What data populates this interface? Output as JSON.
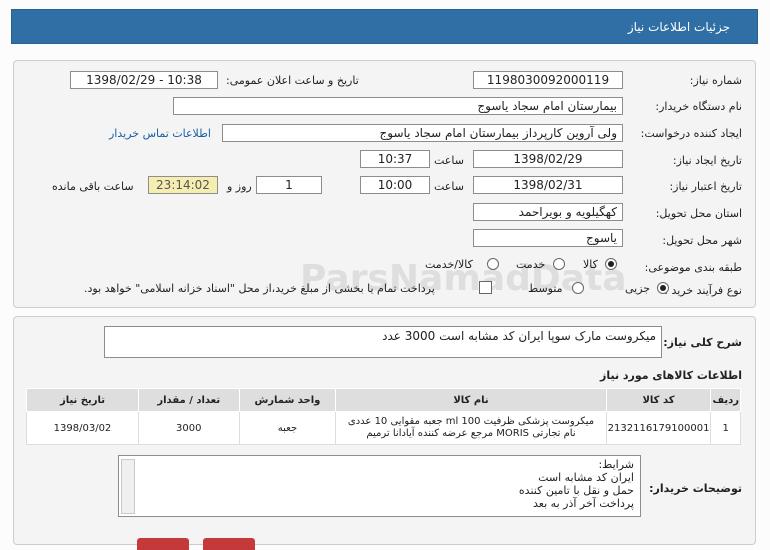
{
  "header": {
    "title": "جزئیات اطلاعات نیاز"
  },
  "form": {
    "need_number_label": "شماره نیاز:",
    "need_number": "1198030092000119",
    "announce_label": "تاریخ و ساعت اعلان عمومی:",
    "announce_value": "1398/02/29 - 10:38",
    "buyer_org_label": "نام دستگاه خریدار:",
    "buyer_org": "بیمارستان امام سجاد یاسوج",
    "requester_label": "ایجاد کننده درخواست:",
    "requester": "ولی آروین کارپرداز بیمارستان امام سجاد یاسوج",
    "contact_link": "اطلاعات تماس خریدار",
    "created_label": "تاریخ ایجاد نیاز:",
    "created_date": "1398/02/29",
    "time_label": "ساعت",
    "created_time": "10:37",
    "valid_label": "تاریخ اعتبار نیاز:",
    "valid_date": "1398/02/31",
    "valid_time": "10:00",
    "days_value": "1",
    "days_label": "روز و",
    "remaining_value": "23:14:02",
    "remaining_label": "ساعت باقی مانده",
    "province_label": "استان محل تحویل:",
    "province": "کهگیلویه و بویراحمد",
    "city_label": "شهر محل تحویل:",
    "city": "یاسوج",
    "category_label": "طبقه بندی موضوعی:",
    "category_options": [
      "کالا",
      "خدمت",
      "کالا/خدمت"
    ],
    "category_selected": "کالا",
    "process_label": "نوع فرآیند خرید :",
    "process_options": [
      "جزیی",
      "متوسط"
    ],
    "process_selected": "جزیی",
    "payment_note": "پرداخت تمام یا بخشی از مبلغ خرید،از محل \"اسناد خزانه اسلامی\" خواهد بود."
  },
  "summary": {
    "label": "شرح کلی نیاز:",
    "value": "میکروست مارک سوپا ایران کد مشابه است 3000 عدد"
  },
  "items_section": {
    "title": "اطلاعات کالاهای مورد نیاز",
    "columns": [
      "ردیف",
      "کد کالا",
      "نام کالا",
      "واحد شمارش",
      "تعداد / مقدار",
      "تاریخ نیاز"
    ],
    "rows": [
      {
        "row": "1",
        "code": "2132116179100001",
        "name_line1": "میکروست پزشکی ظرفیت ml 100 جعبه مقوایی 10 عددی",
        "name_line2": "نام تجارتی MORIS مرجع عرضه کننده آیادانا ترمیم",
        "unit": "جعبه",
        "qty": "3000",
        "date": "1398/03/02"
      }
    ]
  },
  "buyer_notes": {
    "label": "توضیحات خریدار:",
    "lines": [
      "شرایط:",
      "ایران کد مشابه است",
      "حمل و نقل با تامین کننده",
      "پرداخت آخر آذر به بعد"
    ]
  },
  "watermark": {
    "text": "ParsNamadData"
  }
}
